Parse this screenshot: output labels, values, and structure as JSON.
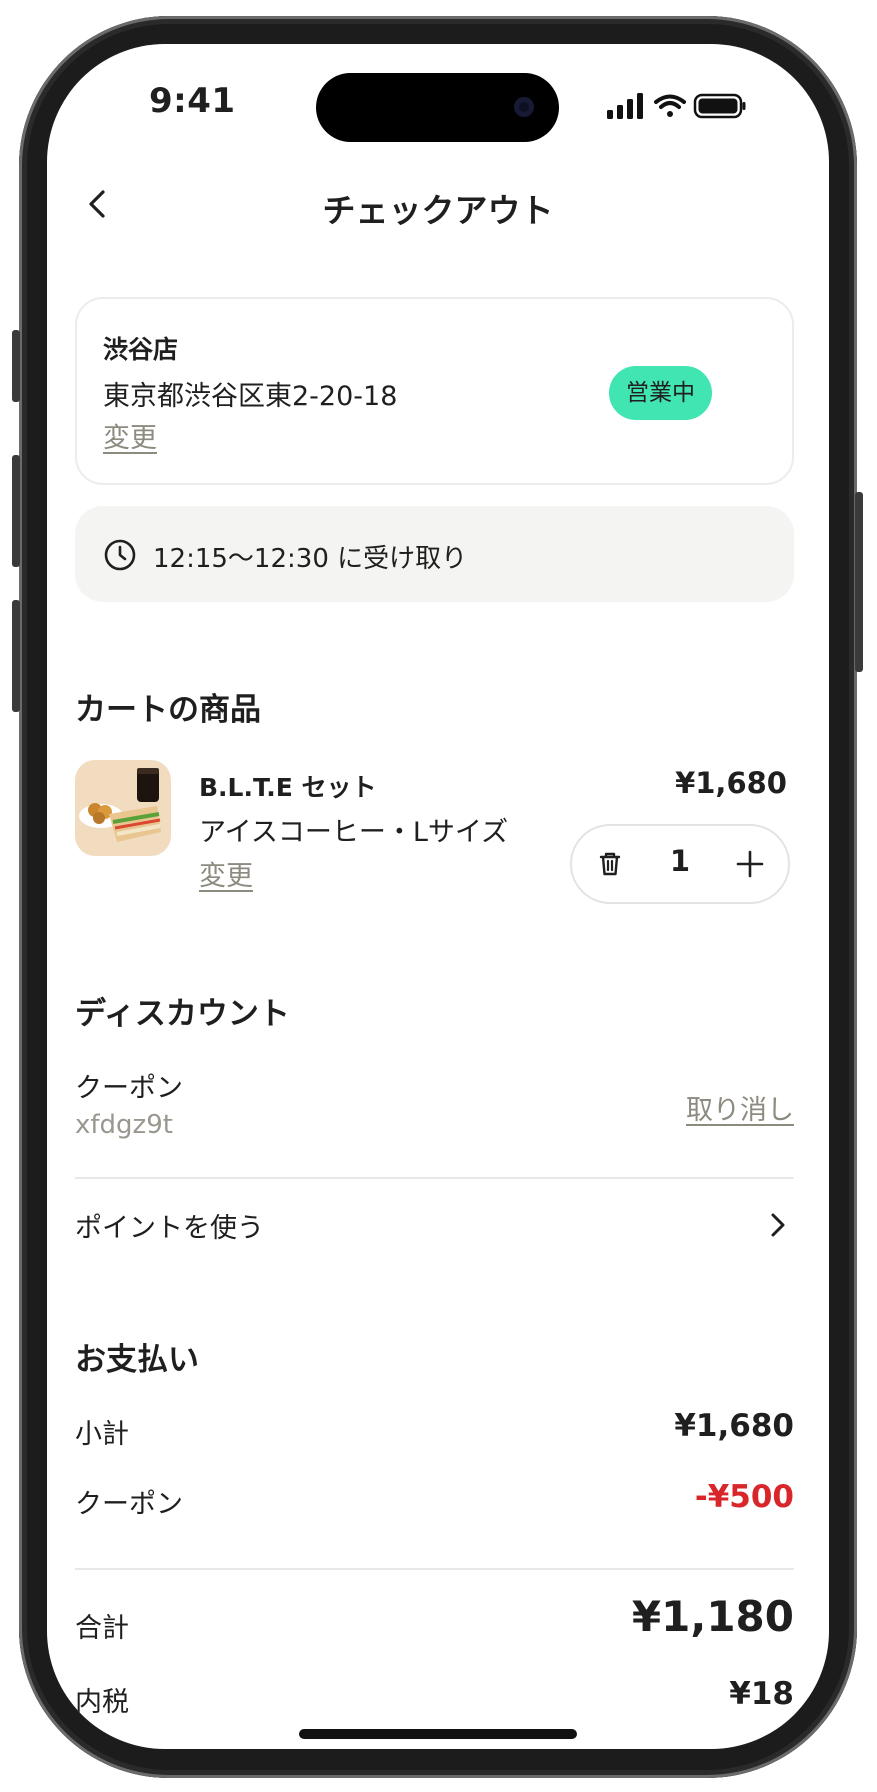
{
  "status_bar": {
    "time": "9:41"
  },
  "nav": {
    "title": "チェックアウト",
    "back_icon": "chevron-left-icon"
  },
  "store": {
    "name": "渋谷店",
    "address": "東京都渋谷区東2-20-18",
    "change_label": "変更",
    "status_badge": "営業中",
    "badge_color": "#40e5b1"
  },
  "pickup": {
    "icon": "clock-icon",
    "text": "12:15〜12:30 に受け取り"
  },
  "cart": {
    "heading": "カートの商品",
    "items": [
      {
        "name": "B.L.T.E セット",
        "option": "アイスコーヒー・Lサイズ",
        "change_label": "変更",
        "price": "¥1,680",
        "quantity": "1"
      }
    ]
  },
  "discount": {
    "heading": "ディスカウント",
    "coupon_label": "クーポン",
    "coupon_code": "xfdgz9t",
    "cancel_label": "取り消し",
    "points_label": "ポイントを使う"
  },
  "payment": {
    "heading": "お支払い",
    "subtotal_label": "小計",
    "subtotal_value": "¥1,680",
    "coupon_label": "クーポン",
    "coupon_value": "-¥500",
    "coupon_color": "#d8262a",
    "total_label": "合計",
    "total_value": "¥1,180",
    "tax_label": "内税",
    "tax_value": "¥18"
  }
}
